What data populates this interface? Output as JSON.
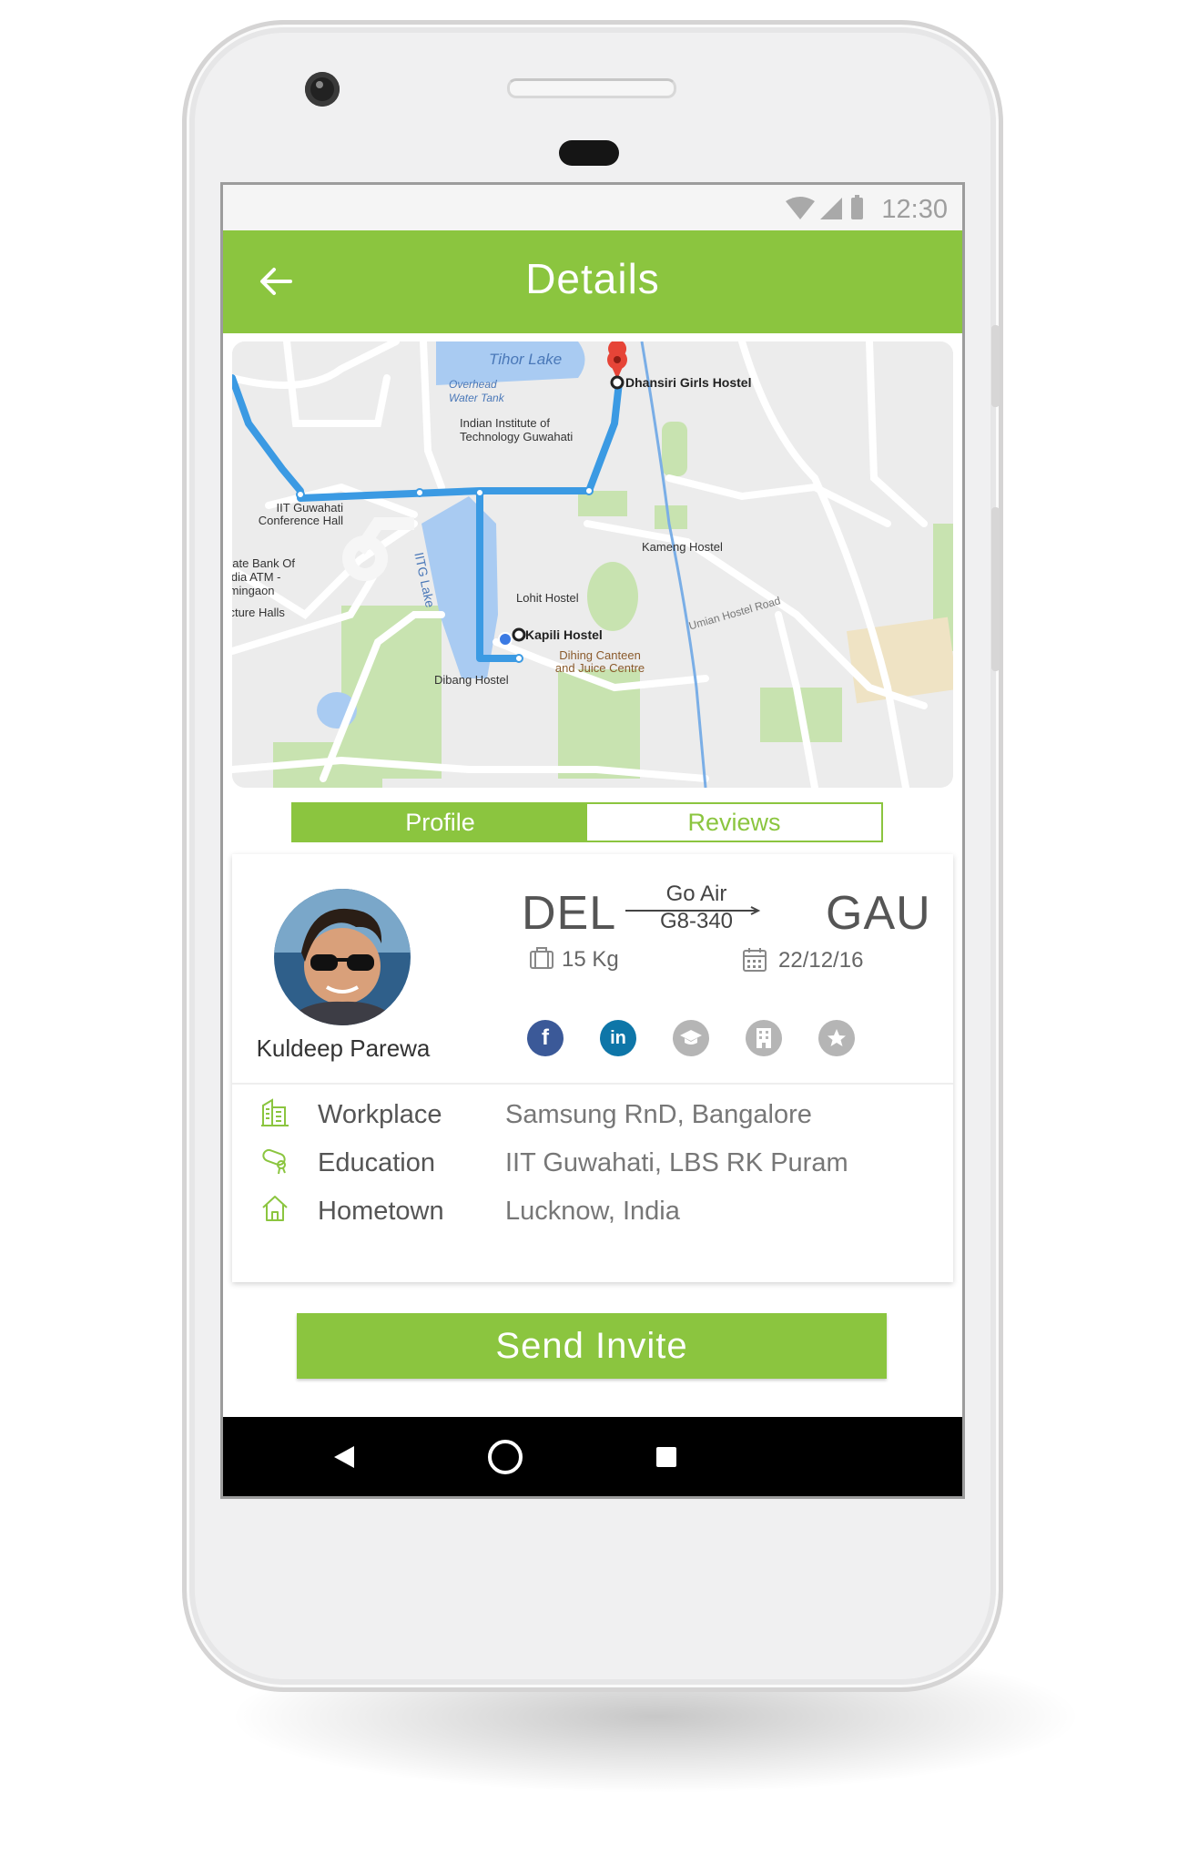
{
  "status_bar": {
    "time": "12:30"
  },
  "app_bar": {
    "title": "Details"
  },
  "map": {
    "labels": {
      "lake1": "Tihor Lake",
      "water_tank": "Overhead Water Tank",
      "dest": "Dhansiri Girls Hostel",
      "iit": "Indian Institute of Technology Guwahati",
      "conf": "IIT Guwahati Conference Hall",
      "bank": "State Bank Of India ATM - Amingaon",
      "lake2": "IITG Lake",
      "kameng": "Kameng Hostel",
      "lohit": "Lohit Hostel",
      "lecture": "Lecture Halls",
      "kapili": "Kapili Hostel",
      "road": "Umian Hostel Road",
      "dihing": "Dihing Canteen and Juice Centre",
      "dibang": "Dibang Hostel"
    }
  },
  "tabs": {
    "profile": "Profile",
    "reviews": "Reviews"
  },
  "profile": {
    "name": "Kuldeep Parewa",
    "from": "DEL",
    "to": "GAU",
    "airline": "Go Air",
    "flight_no": "G8-340",
    "luggage": "15 Kg",
    "date": "22/12/16",
    "social": {
      "facebook": "f",
      "linkedin": "in"
    }
  },
  "details": [
    {
      "label": "Workplace",
      "value": "Samsung RnD, Bangalore",
      "icon": "building-icon"
    },
    {
      "label": "Education",
      "value": "IIT Guwahati, LBS RK Puram",
      "icon": "diploma-icon"
    },
    {
      "label": "Hometown",
      "value": "Lucknow, India",
      "icon": "home-icon"
    }
  ],
  "cta": {
    "send_invite": "Send Invite"
  },
  "colors": {
    "accent": "#8bc53f",
    "route": "#3b9ae3",
    "facebook": "#3b5998",
    "linkedin": "#0e76a8"
  }
}
